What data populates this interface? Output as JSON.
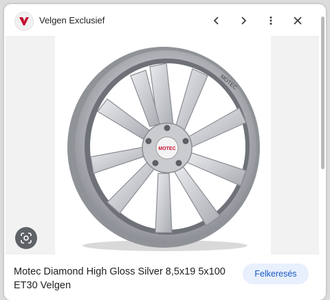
{
  "header": {
    "site_name": "Velgen Exclusief",
    "logo_icon": "velgen-exclusief-logo",
    "prev_icon": "chevron-left-icon",
    "next_icon": "chevron-right-icon",
    "more_icon": "more-vert-icon",
    "close_icon": "close-icon"
  },
  "image": {
    "subject": "silver-alloy-wheel",
    "brand_mark": "MOTEC"
  },
  "lens": {
    "icon": "google-lens-icon"
  },
  "caption": {
    "title": "Motec Diamond High Gloss Silver 8,5x19 5x100 ET30 Velgen"
  },
  "actions": {
    "search_label": "Felkeresés"
  },
  "colors": {
    "accent": "#1a57c0",
    "accent_bg": "#e8f0fe",
    "logo_red": "#c8102e"
  }
}
